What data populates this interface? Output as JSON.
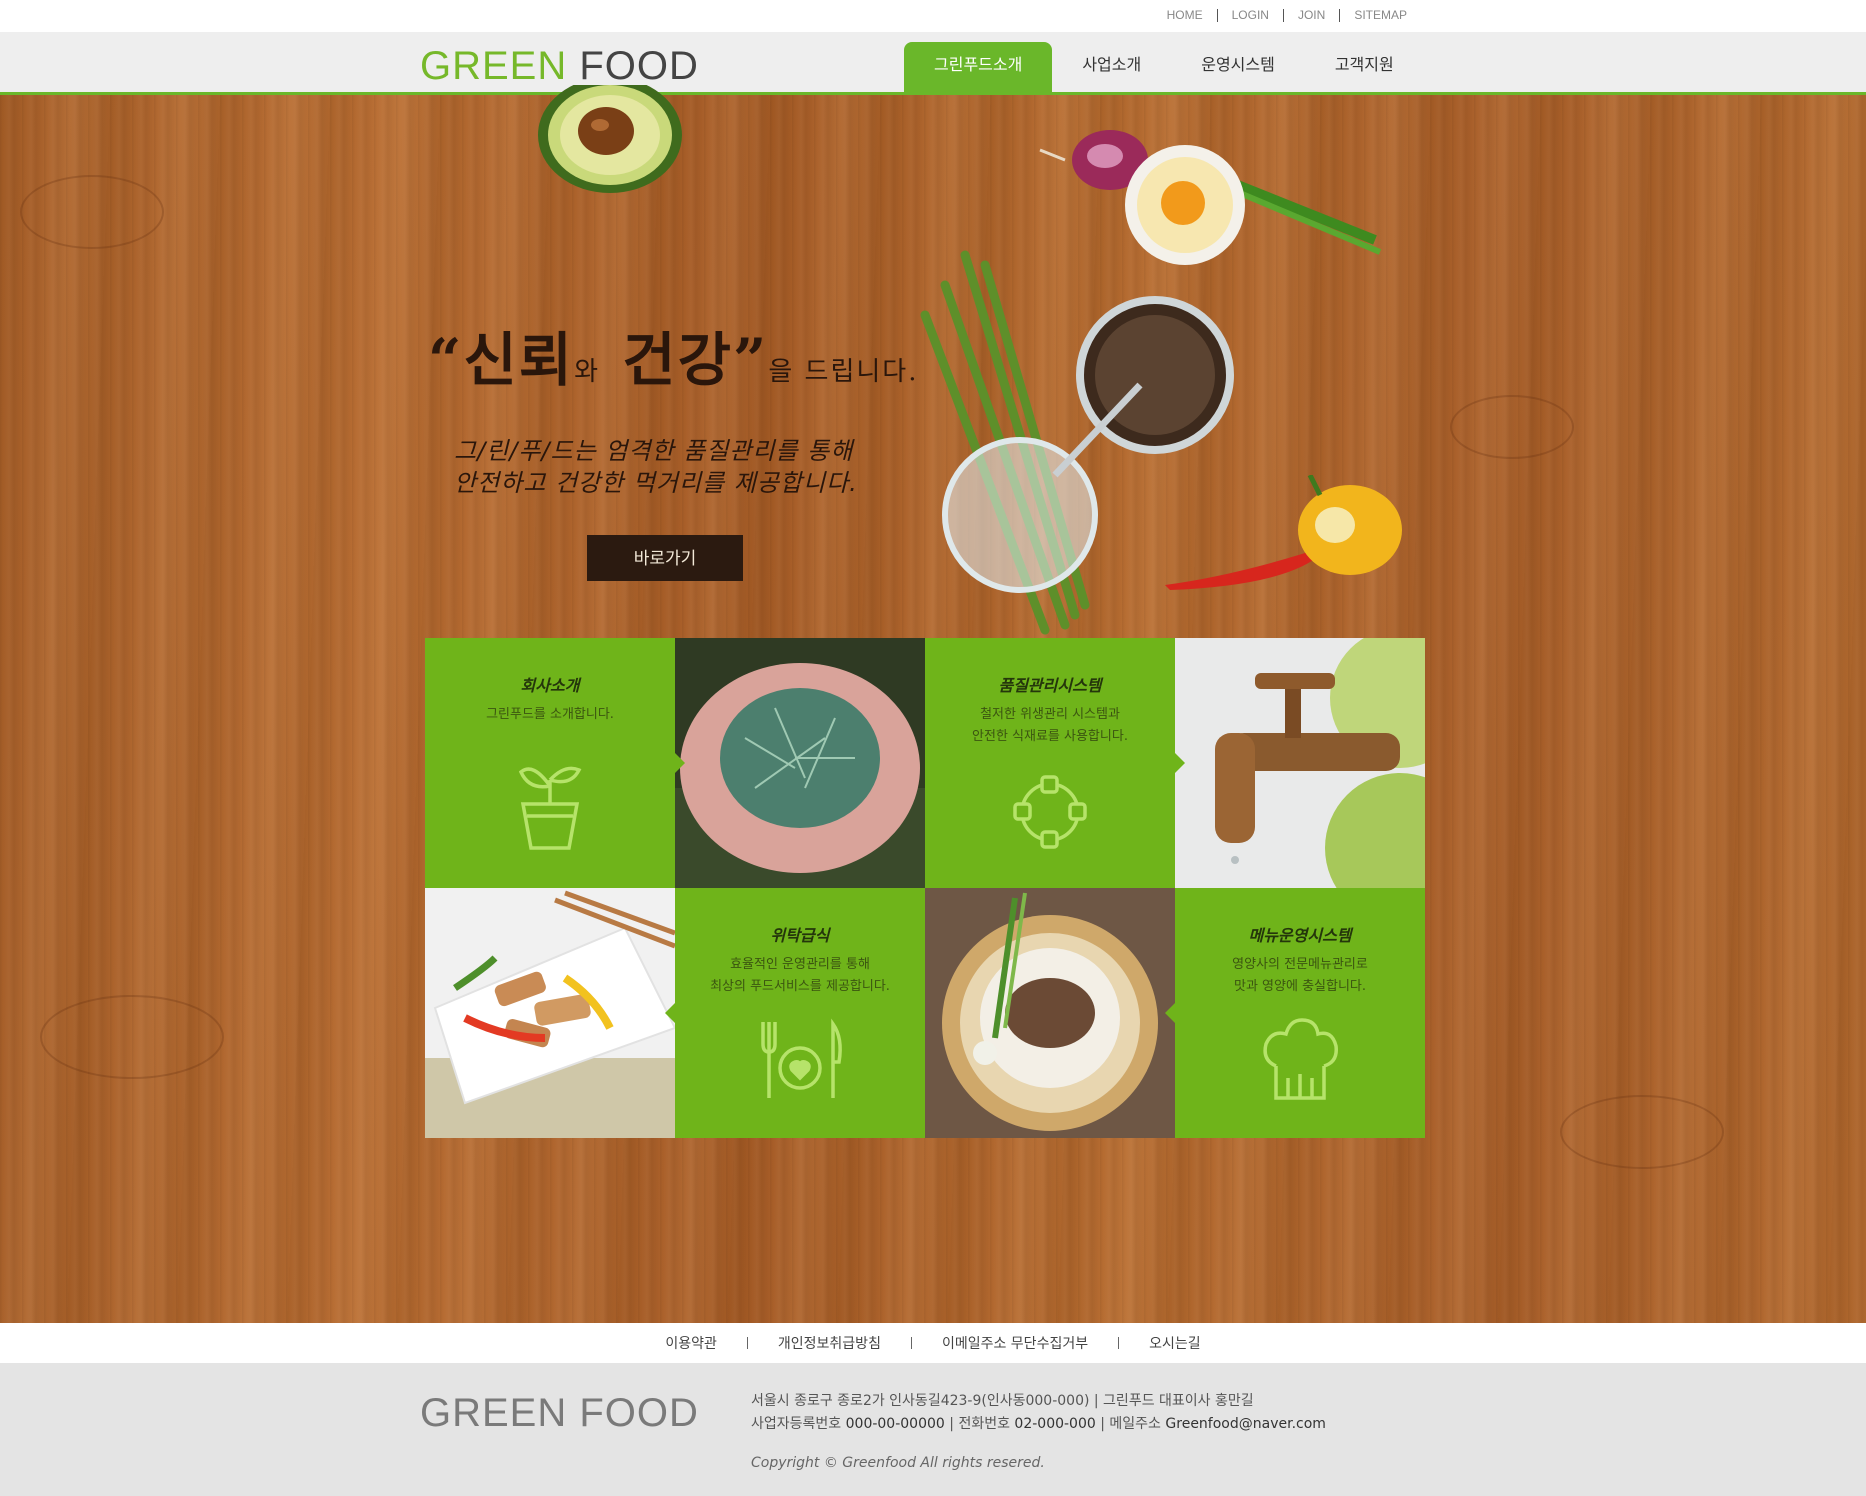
{
  "top_links": [
    "HOME",
    "LOGIN",
    "JOIN",
    "SITEMAP"
  ],
  "logo": {
    "green": "GREEN",
    "dark": "FOOD"
  },
  "nav": {
    "items": [
      "그린푸드소개",
      "사업소개",
      "운영시스템",
      "고객지원"
    ],
    "active_index": 0
  },
  "hero": {
    "quote_open": "“",
    "word1": "신뢰",
    "particle1": "와",
    "word2": "건강",
    "quote_close": "”",
    "tail": "을 드립니다.",
    "desc_line1": "그/린/푸/드는 엄격한 품질관리를 통해",
    "desc_line2": "안전하고 건강한 먹거리를 제공합니다.",
    "button": "바로가기"
  },
  "tiles": [
    {
      "title": "회사소개",
      "lines": [
        "그린푸드를 소개합니다."
      ],
      "icon": "plant-pot-icon"
    },
    {
      "title": "품질관리시스템",
      "lines": [
        "철저한 위생관리 시스템과",
        "안전한 식재료를 사용합니다."
      ],
      "icon": "circle-nodes-icon"
    },
    {
      "title": "위탁급식",
      "lines": [
        "효율적인 운영관리를 통해",
        "최상의 푸드서비스를 제공합니다."
      ],
      "icon": "fork-plate-knife-icon"
    },
    {
      "title": "메뉴운영시스템",
      "lines": [
        "영양사의 전문메뉴관리로",
        "맛과 영양에 충실합니다."
      ],
      "icon": "chef-hat-icon"
    }
  ],
  "footer_links": [
    "이용약관",
    "개인정보취급방침",
    "이메일주소 무단수집거부",
    "오시는길"
  ],
  "footer": {
    "logo": "GREEN FOOD",
    "address": "서울시 종로구 종로2가 인사동길423-9(인사동000-000) | 그린푸드 대표이사 홍만길",
    "biz_label": "사업자등록번호",
    "biz_no": "000-00-00000",
    "tel_label": "전화번호",
    "tel": "02-000-000",
    "email_label": "메일주소",
    "email": "Greenfood@naver.com",
    "copyright": "Copyright © Greenfood All rights resered."
  },
  "colors": {
    "brand_green": "#6ab72a",
    "tile_green": "#6fb41a",
    "dark_button": "#2b1a10"
  }
}
